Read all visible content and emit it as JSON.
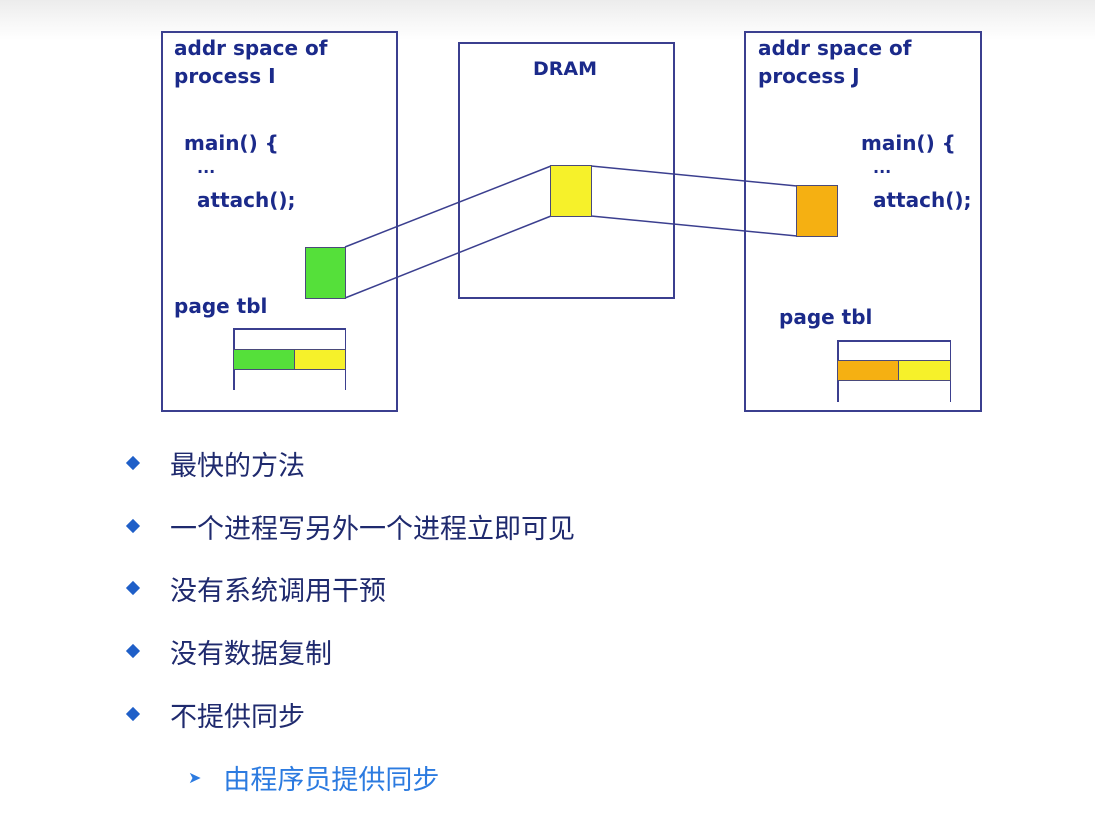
{
  "diagram": {
    "process_i": {
      "title_line1": "addr space of",
      "title_line2": "process I",
      "code_line1": "main() {",
      "code_line2": "...",
      "code_line3": "attach();",
      "page_tbl_label": "page tbl",
      "segment_color": "#55e03a"
    },
    "dram": {
      "title": "DRAM",
      "segment_color": "#f6f12a"
    },
    "process_j": {
      "title_line1": "addr space of",
      "title_line2": "process J",
      "code_line1": "main() {",
      "code_line2": "...",
      "code_line3": "attach();",
      "page_tbl_label": "page tbl",
      "segment_color": "#f5b012"
    },
    "border_color": "#3b3f8f",
    "text_color": "#1b2a8a"
  },
  "bullets": [
    {
      "text": "最快的方法"
    },
    {
      "text": "一个进程写另外一个进程立即可见"
    },
    {
      "text": "没有系统调用干预"
    },
    {
      "text": "没有数据复制"
    },
    {
      "text": "不提供同步"
    }
  ],
  "sub_bullets": [
    {
      "text": "由程序员提供同步"
    }
  ],
  "colors": {
    "bullet_diamond": "#1f5fc8",
    "bullet_text": "#1f2a6e",
    "sub_bullet_text": "#2c7be0"
  }
}
